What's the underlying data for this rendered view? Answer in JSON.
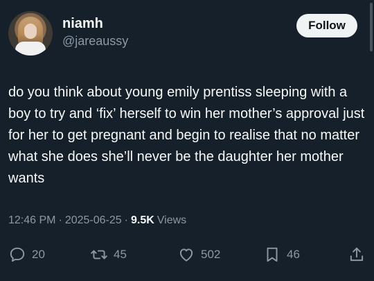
{
  "profile": {
    "display_name": "niamh",
    "handle": "@jareaussy",
    "follow_label": "Follow"
  },
  "tweet": {
    "text": "do you think about young emily prentiss sleeping with a boy to try and ‘fix’ herself to win her mother’s approval just for her to get pregnant and begin to realise that no matter what she does she’ll never be the daughter her mother wants"
  },
  "meta": {
    "time": "12:46 PM",
    "separator": "·",
    "date": "2025-06-25",
    "views_count": "9.5K",
    "views_label": "Views"
  },
  "actions": {
    "replies": "20",
    "retweets": "45",
    "likes": "502",
    "bookmarks": "46"
  },
  "icons": {
    "reply": "reply-icon",
    "retweet": "retweet-icon",
    "like": "heart-icon",
    "bookmark": "bookmark-icon",
    "share": "share-icon"
  },
  "colors": {
    "background": "#15202b",
    "primary_text": "#f7f9f9",
    "secondary_text": "#8b98a5",
    "follow_button_bg": "#eff3f4"
  }
}
